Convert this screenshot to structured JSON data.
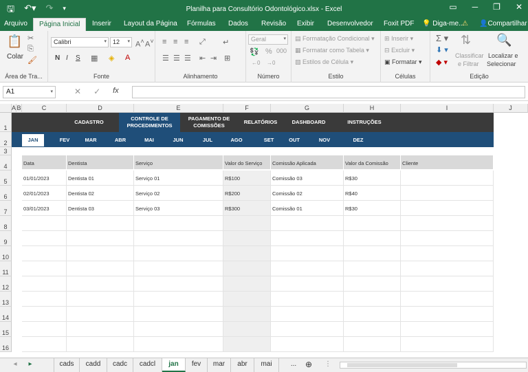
{
  "window": {
    "title": "Planilha para Consultório Odontológico.xlsx - Excel",
    "controls": [
      "▭",
      "─",
      "❐",
      "✕"
    ]
  },
  "menu": {
    "tabs": [
      "Arquivo",
      "Página Inicial",
      "Inserir",
      "Layout da Página",
      "Fórmulas",
      "Dados",
      "Revisão",
      "Exibir",
      "Desenvolvedor",
      "Foxit PDF",
      "Diga-me...",
      "Compartilhar"
    ],
    "active": "Página Inicial"
  },
  "ribbon": {
    "clipboard": {
      "paste": "Colar",
      "label": "Área de Tra..."
    },
    "font": {
      "name": "Calibri",
      "size": "12",
      "label": "Fonte",
      "bold": "N",
      "italic": "I",
      "underline": "S"
    },
    "alignment": {
      "label": "Alinhamento"
    },
    "number": {
      "format": "Geral",
      "label": "Número"
    },
    "styles": {
      "conditional": "Formatação Condicional",
      "table": "Formatar como Tabela",
      "cell": "Estilos de Célula",
      "label": "Estilo"
    },
    "cells": {
      "insert": "Inserir",
      "delete": "Excluir",
      "format": "Formatar",
      "label": "Células"
    },
    "editing": {
      "sort": "Classificar",
      "filter": "e Filtrar",
      "find": "Localizar e",
      "select": "Selecionar",
      "label": "Edição"
    }
  },
  "formula_bar": {
    "name_box": "A1",
    "fx": "fx",
    "value": ""
  },
  "columns": [
    "A",
    "B",
    "C",
    "D",
    "E",
    "F",
    "G",
    "H",
    "I",
    "J"
  ],
  "rows": [
    "1",
    "2",
    "3",
    "4",
    "5",
    "6",
    "7",
    "8",
    "9",
    "10",
    "11",
    "12",
    "13",
    "14",
    "15",
    "16"
  ],
  "nav_menu": [
    "CADASTRO",
    "CONTROLE DE PROCEDIMENTOS",
    "PAGAMENTO DE COMISSÕES",
    "RELATÓRIOS",
    "DASHBOARD",
    "INSTRUÇÕES"
  ],
  "months": [
    "JAN",
    "FEV",
    "MAR",
    "ABR",
    "MAI",
    "JUN",
    "JUL",
    "AGO",
    "SET",
    "OUT",
    "NOV",
    "DEZ"
  ],
  "table": {
    "headers": [
      "Data",
      "Dentista",
      "Serviço",
      "Valor do Serviço",
      "Comissão Aplicada",
      "Valor da Comissão",
      "Cliente"
    ],
    "rows": [
      [
        "01/01/2023",
        "Dentista 01",
        "Serviço 01",
        "R$100",
        "Comissão 03",
        "R$30",
        ""
      ],
      [
        "02/01/2023",
        "Dentista 02",
        "Serviço 02",
        "R$200",
        "Comissão 02",
        "R$40",
        ""
      ],
      [
        "03/01/2023",
        "Dentista 03",
        "Serviço 03",
        "R$300",
        "Comissão 01",
        "R$30",
        ""
      ]
    ]
  },
  "sheet_tabs": [
    "cads",
    "cadd",
    "cadc",
    "cadcl",
    "jan",
    "fev",
    "mar",
    "abr",
    "mai",
    "..."
  ],
  "active_sheet": "jan"
}
